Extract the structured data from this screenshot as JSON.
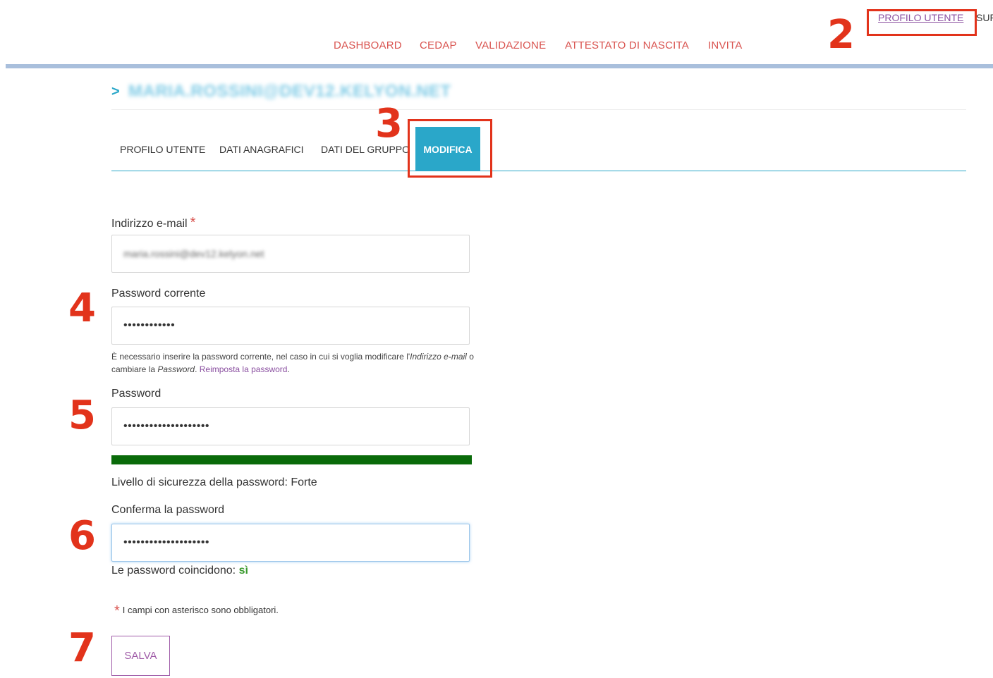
{
  "nav": {
    "items": [
      {
        "label": "DASHBOARD"
      },
      {
        "label": "CEDAP"
      },
      {
        "label": "VALIDAZIONE"
      },
      {
        "label": "ATTESTATO DI NASCITA"
      },
      {
        "label": "INVITA"
      }
    ],
    "profile_link": "PROFILO UTENTE",
    "cut_item": "SUP"
  },
  "breadcrumb": {
    "arrow": ">",
    "user_email_heading": "MARIA.ROSSINI@DEV12.KELYON.NET"
  },
  "tabs": [
    {
      "label": "PROFILO UTENTE",
      "active": false
    },
    {
      "label": "DATI ANAGRAFICI",
      "active": false
    },
    {
      "label": "DATI DEL GRUPPO",
      "active": false
    },
    {
      "label": "MODIFICA",
      "active": true
    }
  ],
  "form": {
    "email_label": "Indirizzo e-mail",
    "required_mark": "*",
    "email_value": "maria.rossini@dev12.kelyon.net",
    "current_password_label": "Password corrente",
    "current_password_value": "••••••••••••",
    "help_text": {
      "part1": "È necessario inserire la password corrente, nel caso in cui si voglia modificare l'",
      "em1": "Indirizzo e-mail",
      "part2": " o cambiare la ",
      "em2": "Password",
      "part3": ". ",
      "link": "Reimposta la password",
      "part4": "."
    },
    "password_label": "Password",
    "password_value": "••••••••••••••••••••",
    "strength_label": "Livello di sicurezza della password: Forte",
    "strength_level": 1.0,
    "confirm_label": "Conferma la password",
    "confirm_value": "••••••••••••••••••••",
    "match_label": "Le password coincidono: ",
    "match_value": "sì",
    "required_note": "I campi con asterisco sono obbligatori.",
    "save_label": "SALVA"
  },
  "annotations": {
    "step2": "2",
    "step3": "3",
    "step4": "4",
    "step5": "5",
    "step6": "6",
    "step7": "7"
  },
  "colors": {
    "nav_link": "#d9534f",
    "accent": "#2aa7c9",
    "annotation_red": "#e2331b",
    "strength_bar": "#0a6b0a",
    "button": "#a05ca8"
  }
}
